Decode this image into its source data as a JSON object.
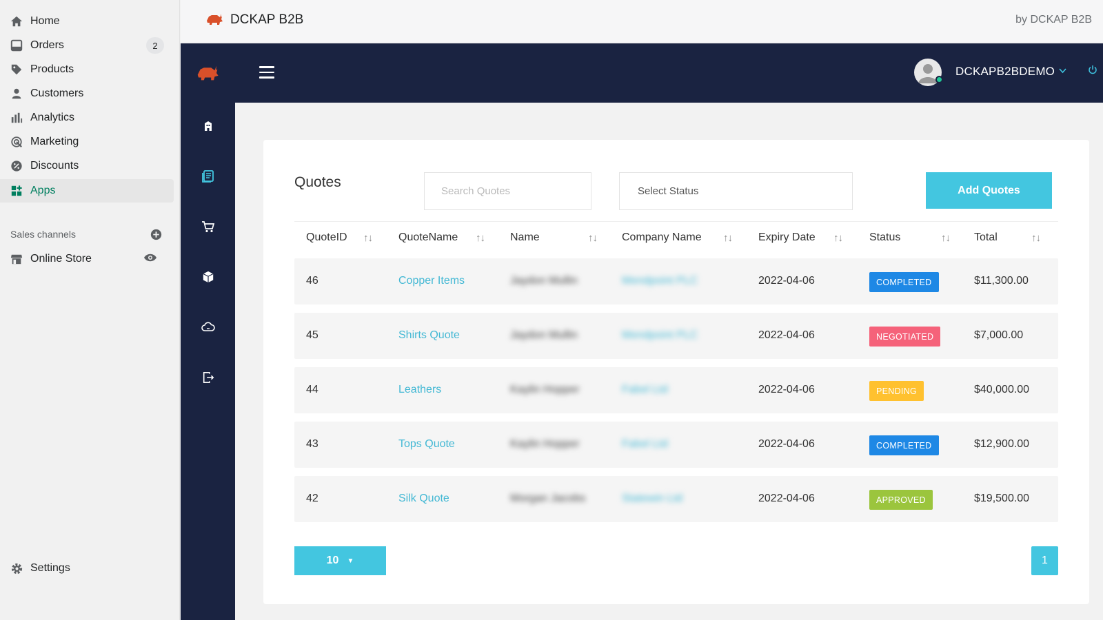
{
  "sidebar": {
    "items": [
      {
        "label": "Home",
        "icon": "home-icon"
      },
      {
        "label": "Orders",
        "icon": "orders-icon",
        "count": "2"
      },
      {
        "label": "Products",
        "icon": "tag-icon"
      },
      {
        "label": "Customers",
        "icon": "person-icon"
      },
      {
        "label": "Analytics",
        "icon": "bar-chart-icon"
      },
      {
        "label": "Marketing",
        "icon": "target-icon"
      },
      {
        "label": "Discounts",
        "icon": "discount-icon"
      },
      {
        "label": "Apps",
        "icon": "apps-icon",
        "active": true
      }
    ],
    "sales_channels_label": "Sales channels",
    "online_store_label": "Online Store",
    "settings_label": "Settings"
  },
  "app_header": {
    "title": "DCKAP B2B",
    "by_text": "by DCKAP B2B"
  },
  "topnav": {
    "username": "DCKAPB2BDEMO"
  },
  "quotes": {
    "title": "Quotes",
    "search_placeholder": "Search Quotes",
    "status_placeholder": "Select Status",
    "add_button": "Add Quotes",
    "columns": [
      "QuoteID",
      "QuoteName",
      "Name",
      "Company Name",
      "Expiry Date",
      "Status",
      "Total"
    ],
    "rows": [
      {
        "id": "46",
        "quote_name": "Copper Items",
        "name": "Jaydon Mullin",
        "company": "Mendpoint PLC",
        "expiry": "2022-04-06",
        "status": "COMPLETED",
        "total": "$11,300.00"
      },
      {
        "id": "45",
        "quote_name": "Shirts Quote",
        "name": "Jaydon Mullin",
        "company": "Mendpoint PLC",
        "expiry": "2022-04-06",
        "status": "NEGOTIATED",
        "total": "$7,000.00"
      },
      {
        "id": "44",
        "quote_name": "Leathers",
        "name": "Kaylin Hopper",
        "company": "Fabel Ltd",
        "expiry": "2022-04-06",
        "status": "PENDING",
        "total": "$40,000.00"
      },
      {
        "id": "43",
        "quote_name": "Tops Quote",
        "name": "Kaylin Hopper",
        "company": "Fabel Ltd",
        "expiry": "2022-04-06",
        "status": "COMPLETED",
        "total": "$12,900.00"
      },
      {
        "id": "42",
        "quote_name": "Silk Quote",
        "name": "Morgan Jacobs",
        "company": "Statewin Ltd",
        "expiry": "2022-04-06",
        "status": "APPROVED",
        "total": "$19,500.00"
      }
    ],
    "page_size": "10",
    "current_page": "1"
  },
  "colors": {
    "accent": "#43c6e0",
    "dark_nav": "#1a2341",
    "completed": "#1e88e5",
    "negotiated": "#f5627a",
    "pending": "#ffc12f",
    "approved": "#9bc53d",
    "brand_logo": "#d9502a"
  }
}
